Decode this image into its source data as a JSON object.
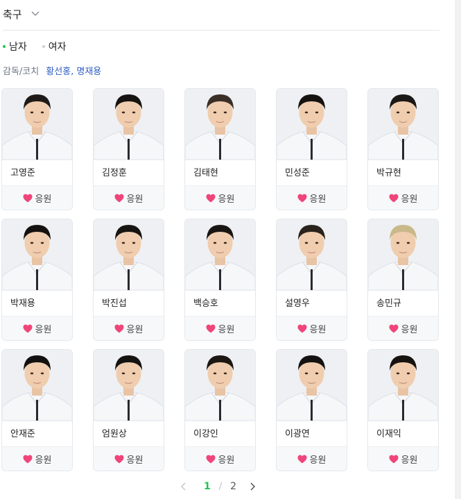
{
  "header": {
    "sport": "축구"
  },
  "gender_tabs": [
    {
      "label": "남자",
      "active": true
    },
    {
      "label": "여자",
      "active": false
    }
  ],
  "coach": {
    "label": "감독/코치",
    "names": "황선홍, 명재용"
  },
  "cheer_label": "응원",
  "players": [
    {
      "name": "고영준",
      "hair": "#1e1a17"
    },
    {
      "name": "김정훈",
      "hair": "#161311"
    },
    {
      "name": "김태현",
      "hair": "#3a2f27"
    },
    {
      "name": "민성준",
      "hair": "#151210"
    },
    {
      "name": "박규현",
      "hair": "#1b1816"
    },
    {
      "name": "박재용",
      "hair": "#141110"
    },
    {
      "name": "박진섭",
      "hair": "#171412"
    },
    {
      "name": "백승호",
      "hair": "#191512"
    },
    {
      "name": "설영우",
      "hair": "#2a221c"
    },
    {
      "name": "송민규",
      "hair": "#c9b98a"
    },
    {
      "name": "안재준",
      "hair": "#131110"
    },
    {
      "name": "엄원상",
      "hair": "#151311"
    },
    {
      "name": "이강인",
      "hair": "#1c1713"
    },
    {
      "name": "이광연",
      "hair": "#141210"
    },
    {
      "name": "이재익",
      "hair": "#161310"
    }
  ],
  "pagination": {
    "current": "1",
    "separator": "/",
    "total": "2"
  },
  "colors": {
    "accent_green": "#19c74c",
    "link_blue": "#2d5dc2",
    "heart": "#f0457a"
  },
  "icons": {
    "dropdown": "chevron-down-icon",
    "heart": "heart-icon",
    "prev": "chevron-left-icon",
    "next": "chevron-right-icon"
  }
}
